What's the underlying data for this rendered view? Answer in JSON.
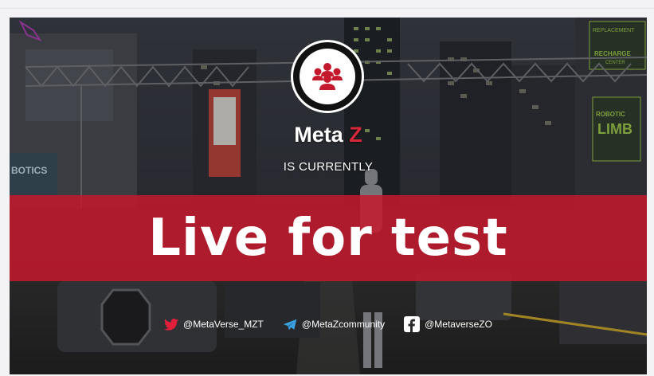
{
  "brand": {
    "name_main": "Meta ",
    "name_accent": "Z"
  },
  "subtitle": "IS CURRENTLY",
  "banner": {
    "text": "Live for test"
  },
  "signs": {
    "left": "BOTICS",
    "right_top": "REPLACEMENT",
    "right_mid": "RECHARGE",
    "right_center": "CENTER",
    "limb": "LIMB",
    "robotic": "ROBOTIC"
  },
  "socials": [
    {
      "icon": "twitter-icon",
      "handle": "@MetaVerse_MZT"
    },
    {
      "icon": "telegram-icon",
      "handle": "@MetaZcommunity"
    },
    {
      "icon": "facebook-icon",
      "handle": "@MetaverseZO"
    }
  ],
  "colors": {
    "accent": "#d6283b",
    "banner": "#c4182c",
    "twitter": "#e0203a",
    "telegram": "#3aa0e0"
  },
  "logo_icon": "group-people-icon"
}
